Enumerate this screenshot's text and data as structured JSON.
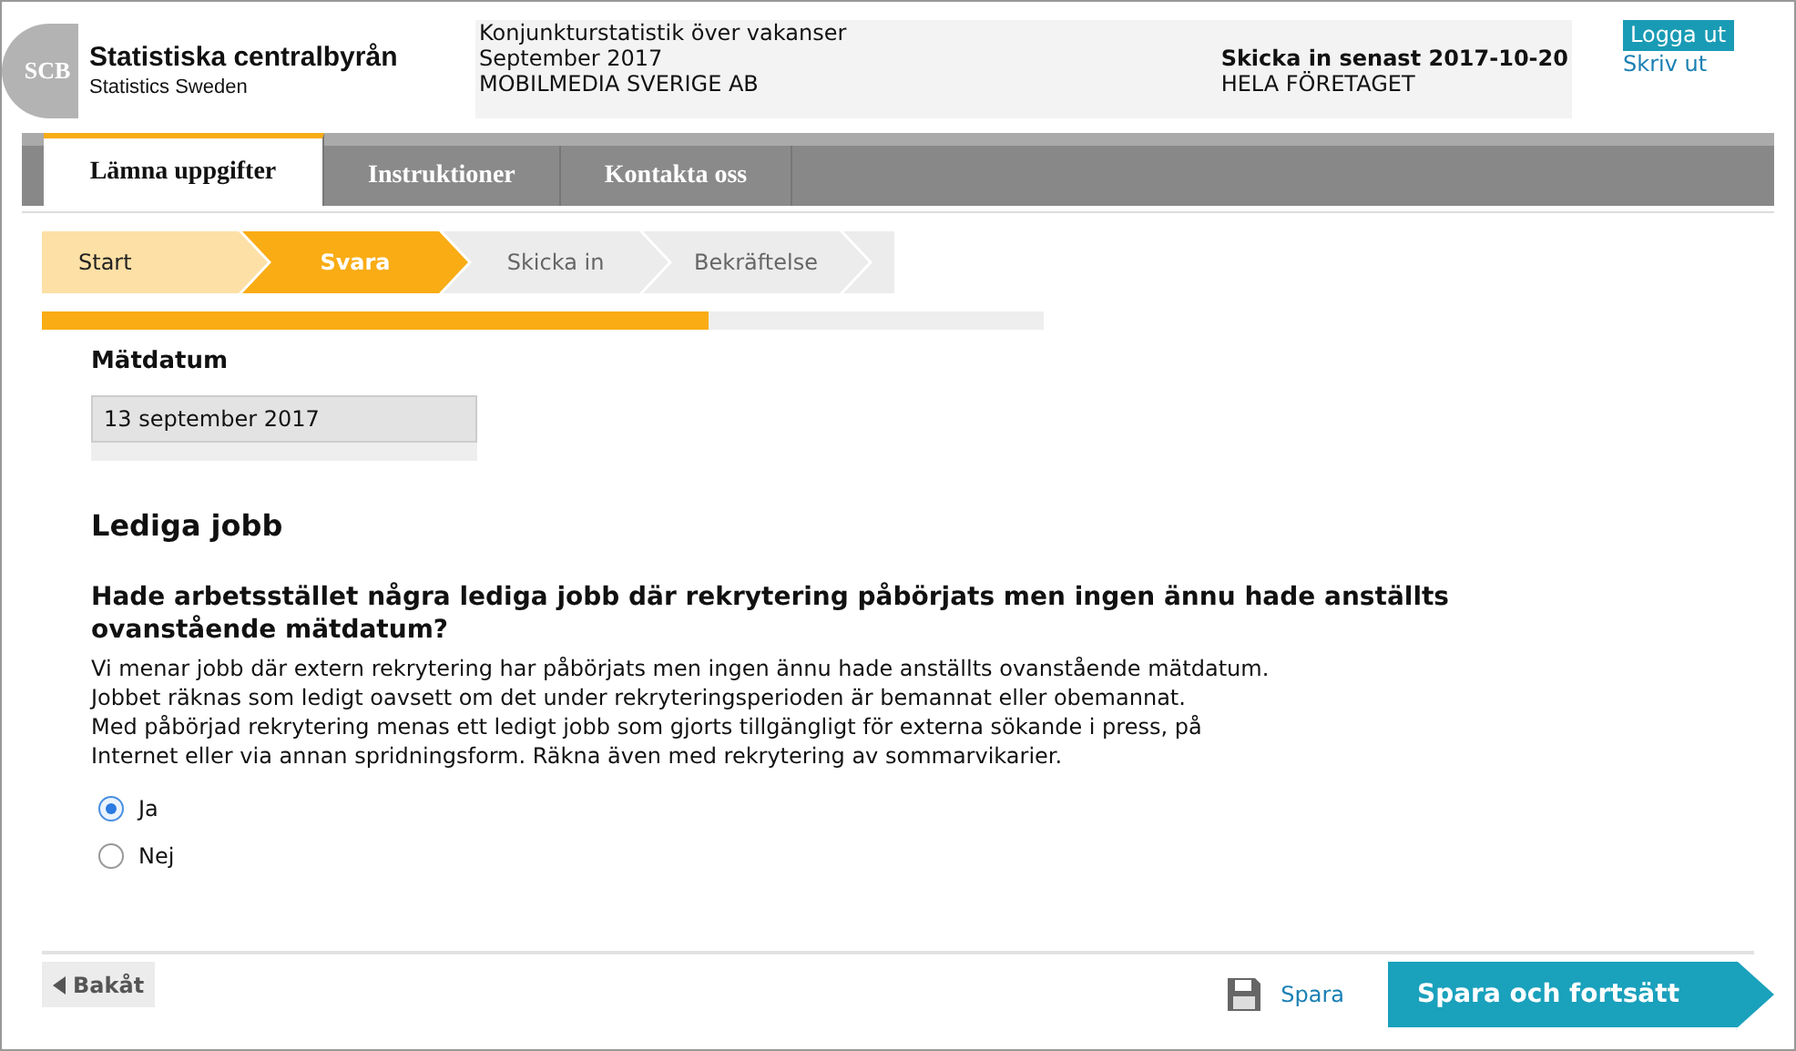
{
  "header": {
    "logo_mark": "SCB",
    "org_name": "Statistiska centralbyrån",
    "org_name_en": "Statistics Sweden",
    "survey": "Konjunkturstatistik över vakanser",
    "period": "September 2017",
    "company": "MOBILMEDIA SVERIGE AB",
    "deadline": "Skicka in senast 2017-10-20",
    "scope": "HELA FÖRETAGET",
    "logout": "Logga ut",
    "print": "Skriv ut"
  },
  "tabs": [
    {
      "label": "Lämna uppgifter",
      "selected": true
    },
    {
      "label": "Instruktioner",
      "selected": false
    },
    {
      "label": "Kontakta oss",
      "selected": false
    }
  ],
  "steps": [
    {
      "label": "Start",
      "kind": "done"
    },
    {
      "label": "Svara",
      "kind": "current"
    },
    {
      "label": "Skicka in",
      "kind": "todo"
    },
    {
      "label": "Bekräftelse",
      "kind": "todo"
    }
  ],
  "progress": {
    "level": 0.665
  },
  "measure_date": {
    "label": "Mätdatum",
    "value": "13 september 2017"
  },
  "section_title": "Lediga jobb",
  "question": {
    "text": "Hade arbetsstället några lediga jobb där rekrytering påbörjats men ingen ännu hade anställts ovanstående mätdatum?",
    "help": [
      "Vi menar jobb där extern rekrytering har påbörjats men ingen ännu hade anställts ovanstående mätdatum. Jobbet räknas som ledigt oavsett om det under rekryteringsperioden är bemannat eller obemannat.",
      "Med påbörjad rekrytering menas ett ledigt jobb som gjorts tillgängligt för externa sökande i press, på Internet eller via annan spridningsform. Räkna även med rekrytering av sommarvikarier."
    ],
    "options": [
      {
        "label": "Ja",
        "selected": true
      },
      {
        "label": "Nej",
        "selected": false
      }
    ]
  },
  "footer": {
    "back": "Bakåt",
    "save": "Spara",
    "save_continue": "Spara och fortsätt"
  }
}
